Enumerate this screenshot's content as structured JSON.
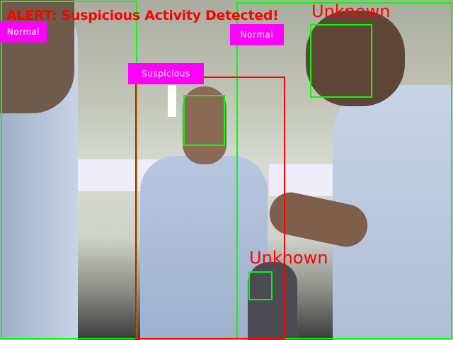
{
  "alert": {
    "text": "ALERT: Suspicious Activity Detected!",
    "color": "#ff0000"
  },
  "labels": {
    "normal_left": "Normal",
    "normal_right": "Normal",
    "suspicious": "Suspicious",
    "unknown_top": "Unknown",
    "unknown_bottom": "Unknown"
  },
  "colors": {
    "normal_box": "#00ff00",
    "suspicious_box": "#ff0000",
    "label_bg": "#ff00ff"
  }
}
